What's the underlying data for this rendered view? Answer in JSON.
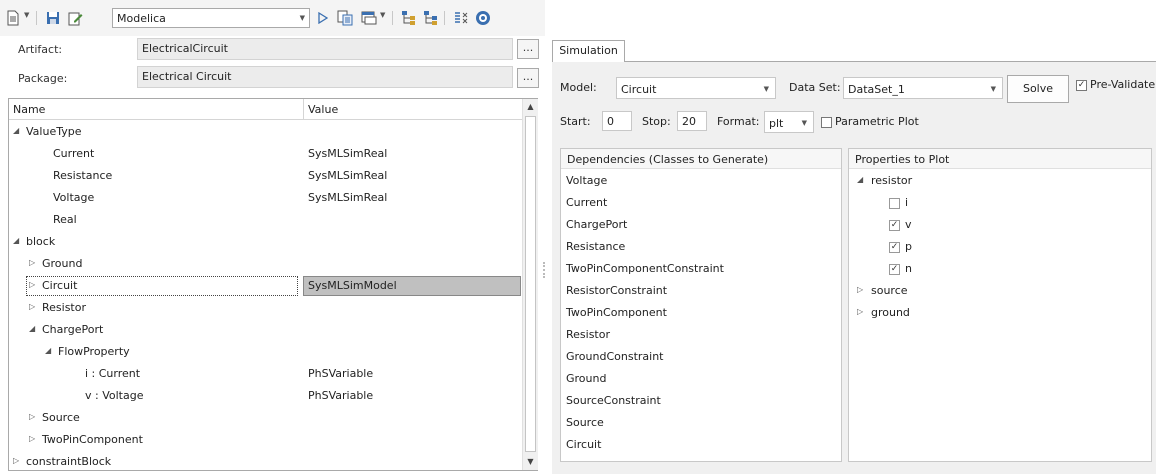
{
  "toolbar": {
    "language": "Modelica",
    "icons": [
      "document-menu-icon",
      "save-icon",
      "edit-icon",
      "run-icon",
      "generate-icon",
      "window-menu-icon",
      "tree-expand-icon",
      "tree-collapse-icon",
      "compare-icon",
      "help-icon"
    ]
  },
  "artifact": {
    "label": "Artifact:",
    "value": "ElectricalCircuit",
    "button": "..."
  },
  "package": {
    "label": "Package:",
    "value": "Electrical Circuit",
    "button": "..."
  },
  "tree": {
    "col_name": "Name",
    "col_value": "Value",
    "rows": [
      {
        "label": "ValueType",
        "value": "",
        "indent": 0,
        "state": "expanded"
      },
      {
        "label": "Current",
        "value": "SysMLSimReal",
        "indent": 2,
        "state": "leaf"
      },
      {
        "label": "Resistance",
        "value": "SysMLSimReal",
        "indent": 2,
        "state": "leaf"
      },
      {
        "label": "Voltage",
        "value": "SysMLSimReal",
        "indent": 2,
        "state": "leaf"
      },
      {
        "label": "Real",
        "value": "",
        "indent": 2,
        "state": "leaf"
      },
      {
        "label": "block",
        "value": "",
        "indent": 0,
        "state": "expanded"
      },
      {
        "label": "Ground",
        "value": "",
        "indent": 1,
        "state": "collapsed"
      },
      {
        "label": "Circuit",
        "value": "SysMLSimModel",
        "indent": 1,
        "state": "collapsed",
        "selected": true
      },
      {
        "label": "Resistor",
        "value": "",
        "indent": 1,
        "state": "collapsed"
      },
      {
        "label": "ChargePort",
        "value": "",
        "indent": 1,
        "state": "expanded"
      },
      {
        "label": "FlowProperty",
        "value": "",
        "indent": 2,
        "state": "expanded"
      },
      {
        "label": "i : Current",
        "value": "PhSVariable",
        "indent": 4,
        "state": "leaf"
      },
      {
        "label": "v : Voltage",
        "value": "PhSVariable",
        "indent": 4,
        "state": "leaf"
      },
      {
        "label": "Source",
        "value": "",
        "indent": 1,
        "state": "collapsed"
      },
      {
        "label": "TwoPinComponent",
        "value": "",
        "indent": 1,
        "state": "collapsed"
      },
      {
        "label": "constraintBlock",
        "value": "",
        "indent": 0,
        "state": "collapsed"
      }
    ]
  },
  "simulation": {
    "tab": "Simulation",
    "model_label": "Model:",
    "model_value": "Circuit",
    "dataset_label": "Data Set:",
    "dataset_value": "DataSet_1",
    "solve": "Solve",
    "prevalidate_label": "Pre-Validate",
    "prevalidate_checked": true,
    "start_label": "Start:",
    "start_value": "0",
    "stop_label": "Stop:",
    "stop_value": "20",
    "format_label": "Format:",
    "format_value": "plt",
    "parametric_label": "Parametric Plot",
    "parametric_checked": false,
    "dependencies_header": "Dependencies (Classes to Generate)",
    "dependencies": [
      "Voltage",
      "Current",
      "ChargePort",
      "Resistance",
      "TwoPinComponentConstraint",
      "ResistorConstraint",
      "TwoPinComponent",
      "Resistor",
      "GroundConstraint",
      "Ground",
      "SourceConstraint",
      "Source",
      "Circuit"
    ],
    "properties_header": "Properties to Plot",
    "properties": [
      {
        "label": "resistor",
        "kind": "expanded",
        "checked": null
      },
      {
        "label": "i",
        "kind": "check",
        "checked": false
      },
      {
        "label": "v",
        "kind": "check",
        "checked": true
      },
      {
        "label": "p",
        "kind": "check",
        "checked": true
      },
      {
        "label": "n",
        "kind": "check",
        "checked": true
      },
      {
        "label": "source",
        "kind": "collapsed",
        "checked": null
      },
      {
        "label": "ground",
        "kind": "collapsed",
        "checked": null
      }
    ]
  }
}
